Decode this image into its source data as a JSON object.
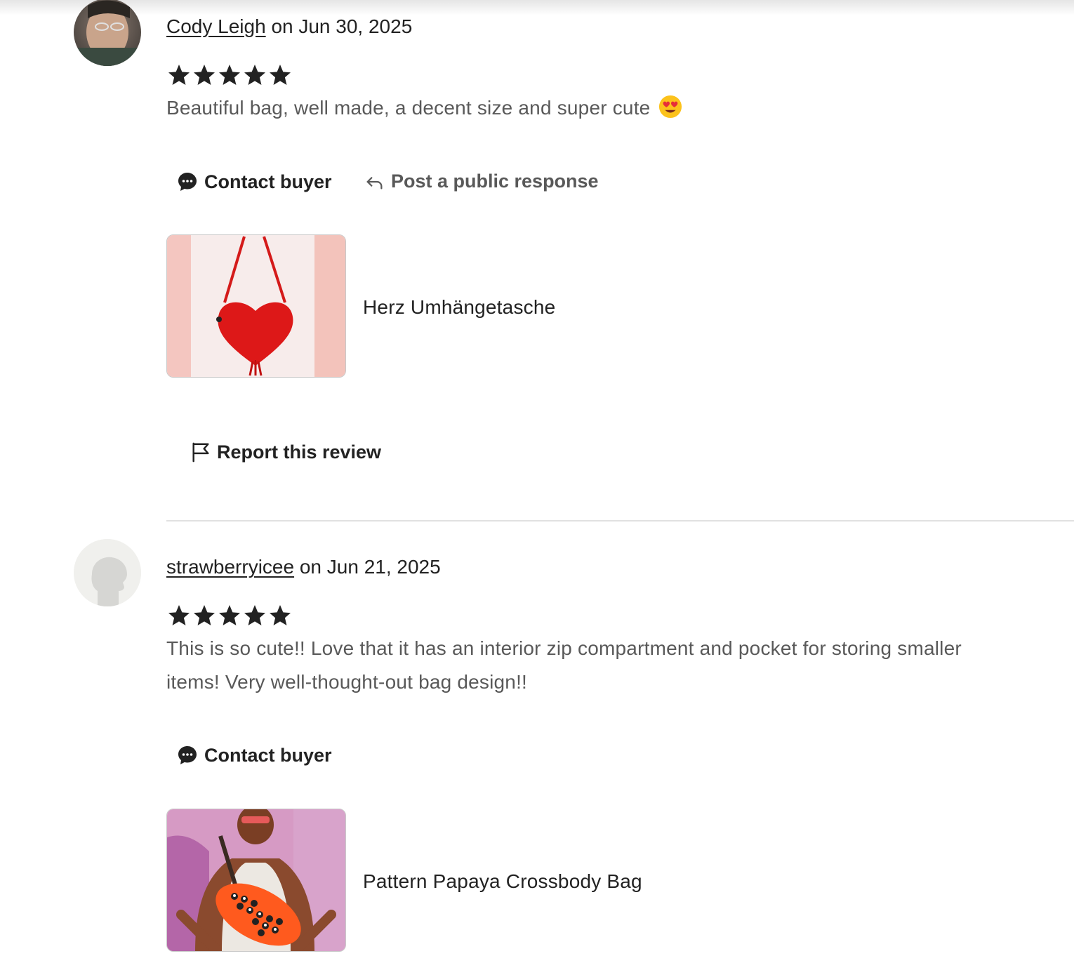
{
  "reviews": [
    {
      "reviewer": "Cody Leigh",
      "date_text": "on Jun 30, 2025",
      "rating": 5,
      "text": "Beautiful bag, well made, a decent size and super cute",
      "emoji": "heart-eyes-emoji",
      "actions": {
        "contact": "Contact buyer",
        "respond": "Post a public response",
        "report": "Report this review"
      },
      "item": {
        "name": "Herz Umhängetasche"
      }
    },
    {
      "reviewer": "strawberryicee",
      "date_text": "on Jun 21, 2025",
      "rating": 5,
      "text": "This is so cute!! Love that it has an interior zip compartment and pocket for storing smaller items! Very well-thought-out bag design!!",
      "actions": {
        "contact": "Contact buyer"
      },
      "item": {
        "name": "Pattern Papaya Crossbody Bag"
      }
    }
  ],
  "colors": {
    "text": "#222222",
    "muted": "#595959",
    "divider": "#e1e1e1"
  }
}
